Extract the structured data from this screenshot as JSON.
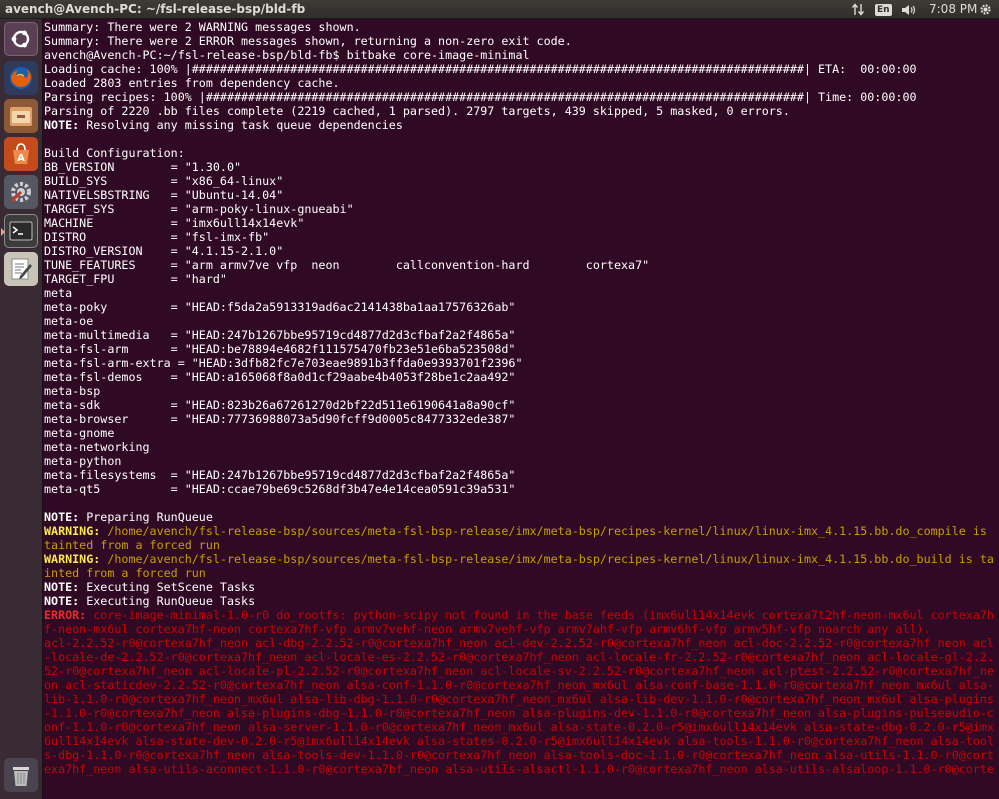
{
  "topbar": {
    "window_title": "avench@Avench-PC: ~/fsl-release-bsp/bld-fb",
    "keyboard_layout": "En",
    "clock": "7:08 PM",
    "icons": [
      "network-arrows-icon",
      "keyboard-layout-indicator",
      "volume-icon",
      "settings-gear-icon"
    ]
  },
  "launcher": {
    "items": [
      {
        "name": "dash-home-icon",
        "app": "Search your computer"
      },
      {
        "name": "firefox-icon",
        "app": "Firefox Web Browser"
      },
      {
        "name": "files-icon",
        "app": "Files"
      },
      {
        "name": "software-center-icon",
        "app": "Ubuntu Software Center"
      },
      {
        "name": "system-settings-icon",
        "app": "System Settings"
      },
      {
        "name": "terminal-icon",
        "app": "Terminal"
      },
      {
        "name": "text-editor-icon",
        "app": "Text Editor"
      },
      {
        "name": "trash-icon",
        "app": "Trash"
      }
    ]
  },
  "colors": {
    "terminal_bg": "#300a24",
    "text": "#ffffff",
    "warning": "#c4a000",
    "error": "#cc0000"
  },
  "terminal": {
    "lines": [
      {
        "t": "Summary: There were 2 WARNING messages shown."
      },
      {
        "t": "Summary: There were 2 ERROR messages shown, returning a non-zero exit code."
      },
      {
        "t": "avench@Avench-PC:~/fsl-release-bsp/bld-fb$ bitbake core-image-minimal"
      },
      {
        "t": "Loading cache: 100% |#######################################################################################| ETA:  00:00:00"
      },
      {
        "t": "Loaded 2803 entries from dependency cache."
      },
      {
        "t": "Parsing recipes: 100% |#####################################################################################| Time: 00:00:00"
      },
      {
        "t": "Parsing of 2220 .bb files complete (2219 cached, 1 parsed). 2797 targets, 439 skipped, 5 masked, 0 errors."
      },
      {
        "label": "NOTE:",
        "t": " Resolving any missing task queue dependencies",
        "k": "note"
      },
      {
        "t": ""
      },
      {
        "t": "Build Configuration:"
      },
      {
        "t": "BB_VERSION        = \"1.30.0\""
      },
      {
        "t": "BUILD_SYS         = \"x86_64-linux\""
      },
      {
        "t": "NATIVELSBSTRING   = \"Ubuntu-14.04\""
      },
      {
        "t": "TARGET_SYS        = \"arm-poky-linux-gnueabi\""
      },
      {
        "t": "MACHINE           = \"imx6ull14x14evk\""
      },
      {
        "t": "DISTRO            = \"fsl-imx-fb\""
      },
      {
        "t": "DISTRO_VERSION    = \"4.1.15-2.1.0\""
      },
      {
        "t": "TUNE_FEATURES     = \"arm armv7ve vfp  neon        callconvention-hard        cortexa7\""
      },
      {
        "t": "TARGET_FPU        = \"hard\""
      },
      {
        "t": "meta"
      },
      {
        "t": "meta-poky         = \"HEAD:f5da2a5913319ad6ac2141438ba1aa17576326ab\""
      },
      {
        "t": "meta-oe"
      },
      {
        "t": "meta-multimedia   = \"HEAD:247b1267bbe95719cd4877d2d3cfbaf2a2f4865a\""
      },
      {
        "t": "meta-fsl-arm      = \"HEAD:be78894e4682f111575470fb23e51e6ba523508d\""
      },
      {
        "t": "meta-fsl-arm-extra = \"HEAD:3dfb82fc7e703eae9891b3ffda0e9393701f2396\""
      },
      {
        "t": "meta-fsl-demos    = \"HEAD:a165068f8a0d1cf29aabe4b4053f28be1c2aa492\""
      },
      {
        "t": "meta-bsp"
      },
      {
        "t": "meta-sdk          = \"HEAD:823b26a67261270d2bf22d511e6190641a8a90cf\""
      },
      {
        "t": "meta-browser      = \"HEAD:77736988073a5d90fcff9d0005c8477332ede387\""
      },
      {
        "t": "meta-gnome"
      },
      {
        "t": "meta-networking"
      },
      {
        "t": "meta-python"
      },
      {
        "t": "meta-filesystems  = \"HEAD:247b1267bbe95719cd4877d2d3cfbaf2a2f4865a\""
      },
      {
        "t": "meta-qt5          = \"HEAD:ccae79be69c5268df3b47e4e14cea0591c39a531\""
      },
      {
        "t": ""
      },
      {
        "label": "NOTE:",
        "t": " Preparing RunQueue",
        "k": "note"
      },
      {
        "label": "WARNING:",
        "t": " /home/avench/fsl-release-bsp/sources/meta-fsl-bsp-release/imx/meta-bsp/recipes-kernel/linux/linux-imx_4.1.15.bb.do_compile is tainted from a forced run",
        "k": "warn"
      },
      {
        "label": "WARNING:",
        "t": " /home/avench/fsl-release-bsp/sources/meta-fsl-bsp-release/imx/meta-bsp/recipes-kernel/linux/linux-imx_4.1.15.bb.do_build is tainted from a forced run",
        "k": "warn"
      },
      {
        "label": "NOTE:",
        "t": " Executing SetScene Tasks",
        "k": "note"
      },
      {
        "label": "NOTE:",
        "t": " Executing RunQueue Tasks",
        "k": "note"
      },
      {
        "label": "ERROR:",
        "t": " core-image-minimal-1.0-r0 do_rootfs: python-scipy not found in the base feeds (imx6ull14x14evk cortexa7t2hf-neon-mx6ul cortexa7hf-neon-mx6ul cortexa7hf-neon cortexa7hf-vfp armv7vehf-neon armv7vehf-vfp armv7ahf-vfp armv6hf-vfp armv5hf-vfp noarch any all).",
        "k": "err"
      },
      {
        "t": "acl-2.2.52-r0@cortexa7hf_neon acl-dbg-2.2.52-r0@cortexa7hf_neon acl-dev-2.2.52-r0@cortexa7hf_neon acl-doc-2.2.52-r0@cortexa7hf_neon acl-locale-de-2.2.52-r0@cortexa7hf_neon acl-locale-es-2.2.52-r0@cortexa7hf_neon acl-locale-fr-2.2.52-r0@cortexa7hf_neon acl-locale-gl-2.2.52-r0@cortexa7hf_neon acl-locale-pl-2.2.52-r0@cortexa7hf_neon acl-locale-sv-2.2.52-r0@cortexa7hf_neon acl-ptest-2.2.52-r0@cortexa7hf_neon acl-staticdev-2.2.52-r0@cortexa7hf_neon alsa-conf-1.1.0-r0@cortexa7hf_neon_mx6ul alsa-conf-base-1.1.0-r0@cortexa7hf_neon_mx6ul alsa-lib-1.1.0-r0@cortexa7hf_neon_mx6ul alsa-lib-dbg-1.1.0-r0@cortexa7hf_neon_mx6ul alsa-lib-dev-1.1.0-r0@cortexa7hf_neon_mx6ul alsa-plugins-1.1.0-r0@cortexa7hf_neon alsa-plugins-dbg-1.1.0-r0@cortexa7hf_neon alsa-plugins-dev-1.1.0-r0@cortexa7hf_neon alsa-plugins-pulseaudio-conf-1.1.0-r0@cortexa7hf_neon alsa-server-1.1.0-r0@cortexa7hf_neon_mx6ul alsa-state-0.2.0-r5@imx6ull14x14evk alsa-state-dbg-0.2.0-r5@imx6ull14x14evk alsa-state-dev-0.2.0-r5@imx6ull14x14evk alsa-states-0.2.0-r5@imx6ull14x14evk alsa-tools-1.1.0-r0@cortexa7hf_neon alsa-tools-dbg-1.1.0-r0@cortexa7hf_neon alsa-tools-dev-1.1.0-r0@cortexa7hf_neon alsa-tools-doc-1.1.0-r0@cortexa7hf_neon alsa-utils-1.1.0-r0@cortexa7hf_neon alsa-utils-aconnect-1.1.0-r0@cortexa7hf_neon alsa-utils-alsactl-1.1.0-r0@cortexa7hf_neon alsa-utils-alsaloop-1.1.0-r0@corte",
        "k": "errtext"
      }
    ]
  }
}
